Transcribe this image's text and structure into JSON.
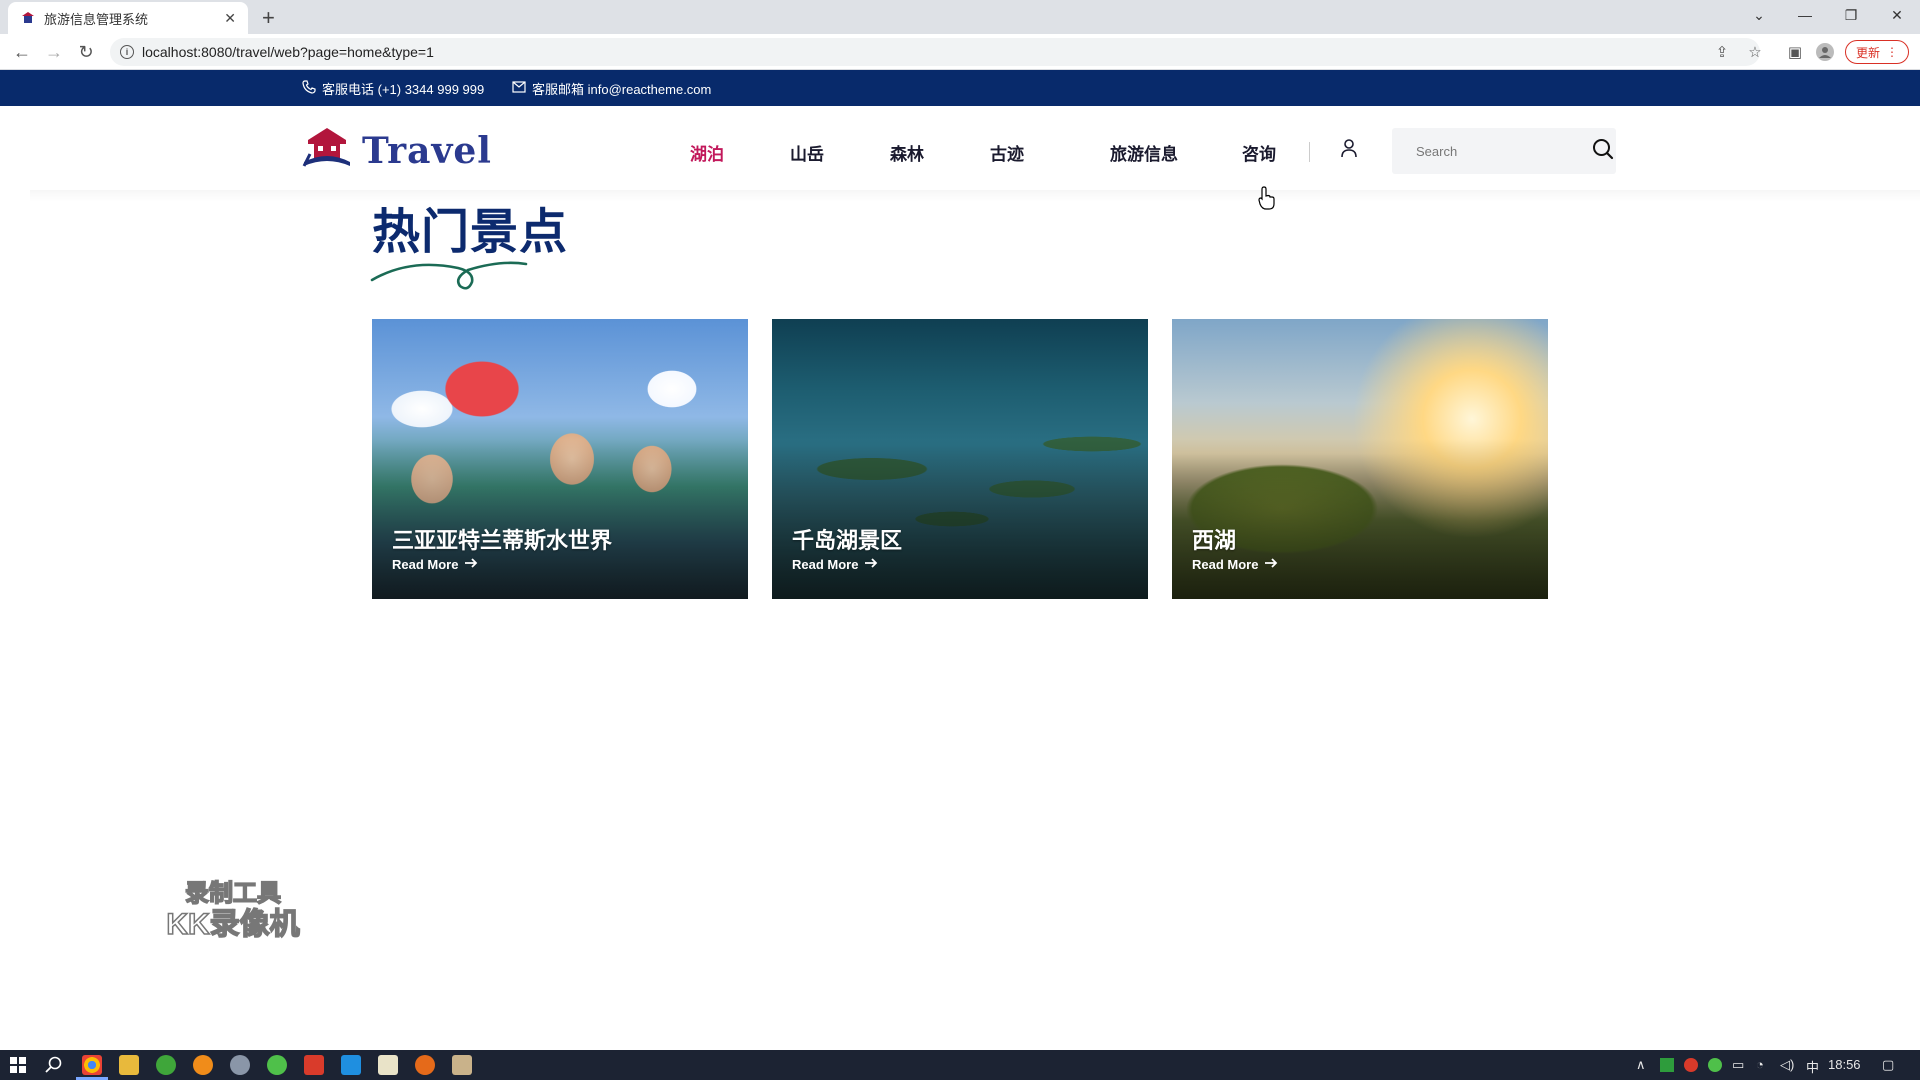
{
  "browser": {
    "tab_title": "旅游信息管理系统",
    "url": "localhost:8080/travel/web?page=home&type=1",
    "update_label": "更新"
  },
  "topbar": {
    "phone": "客服电话 (+1) 3344 999 999",
    "email": "客服邮箱 info@reactheme.com"
  },
  "header": {
    "logo_text": "Travel",
    "nav": [
      "湖泊",
      "山岳",
      "森林",
      "古迹",
      "旅游信息",
      "咨询"
    ],
    "active_nav_index": 0,
    "search_placeholder": "Search"
  },
  "section": {
    "title": "热门景点",
    "read_more": "Read More",
    "cards": [
      {
        "title": "三亚亚特兰蒂斯水世界"
      },
      {
        "title": "千岛湖景区"
      },
      {
        "title": "西湖"
      }
    ]
  },
  "watermark": {
    "line1": "录制工具",
    "line2": "KK录像机"
  },
  "taskbar": {
    "ime": "中",
    "time": "18:56"
  },
  "colors": {
    "brand_navy": "#082a6b",
    "title_navy": "#0c2a6e",
    "active_nav": "#c2185b",
    "squiggle_green": "#1b6b55"
  }
}
